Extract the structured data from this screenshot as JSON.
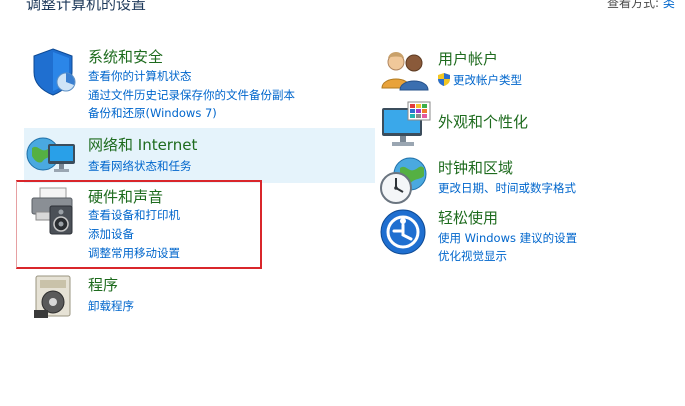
{
  "header": {
    "title": "调整计算机的设置",
    "view_by_label": "查看方式:",
    "view_by_value": "类"
  },
  "left": [
    {
      "title": "系统和安全",
      "links": [
        "查看你的计算机状态",
        "通过文件历史记录保存你的文件备份副本",
        "备份和还原(Windows 7)"
      ]
    },
    {
      "title": "网络和 Internet",
      "links": [
        "查看网络状态和任务"
      ]
    },
    {
      "title": "硬件和声音",
      "links": [
        "查看设备和打印机",
        "添加设备",
        "调整常用移动设置"
      ]
    },
    {
      "title": "程序",
      "links": [
        "卸载程序"
      ]
    }
  ],
  "right": [
    {
      "title": "用户帐户",
      "links": [
        "更改帐户类型"
      ]
    },
    {
      "title": "外观和个性化",
      "links": []
    },
    {
      "title": "时钟和区域",
      "links": [
        "更改日期、时间或数字格式"
      ]
    },
    {
      "title": "轻松使用",
      "links": [
        "使用 Windows 建议的设置",
        "优化视觉显示"
      ]
    }
  ],
  "colors": {
    "category_title": "#1e6b1e",
    "link": "#0066cc",
    "hover_background": "#e5f3fb",
    "annotation_box": "#d9262b"
  }
}
